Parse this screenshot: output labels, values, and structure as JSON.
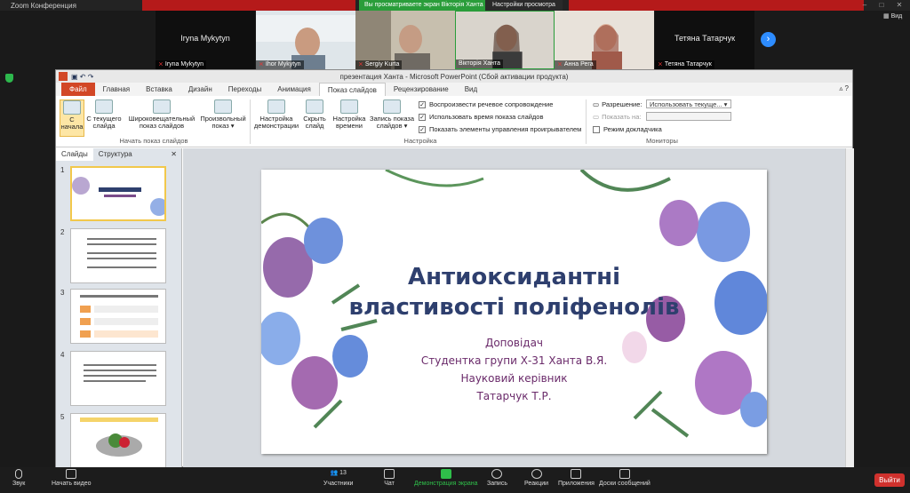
{
  "zoom": {
    "window_title": "Zoom Конференция",
    "share_banner": "Вы просматриваете экран Вікторія Ханта",
    "view_options": "Настройки просмотра",
    "view_btn": "Вид"
  },
  "participants": [
    {
      "label": "Iryna Mykytyn",
      "name": "Iryna Mykytyn",
      "video": false
    },
    {
      "label": "Ihor Mykytyn",
      "video": true
    },
    {
      "label": "Sergiy Kurta",
      "video": true
    },
    {
      "label": "Вікторія Ханта",
      "video": true
    },
    {
      "label": "Анна Рега",
      "video": true
    },
    {
      "label": "Тетяна Татарчук",
      "name": "Тетяна Татарчук",
      "video": false
    }
  ],
  "ppt": {
    "title": "презентация Ханта  -  Microsoft PowerPoint (Сбой активации продукта)",
    "tabs": [
      "Файл",
      "Главная",
      "Вставка",
      "Дизайн",
      "Переходы",
      "Анимация",
      "Показ слайдов",
      "Рецензирование",
      "Вид"
    ],
    "active_tab": "Показ слайдов",
    "ribbon": {
      "from_start": "С\nначала",
      "from_current": "С текущего\nслайда",
      "broadcast": "Широковещательный\nпоказ слайдов",
      "custom": "Произвольный\nпоказ ▾",
      "group1": "Начать показ слайдов",
      "setup": "Настройка\nдемонстрации",
      "hide": "Скрыть\nслайд",
      "rehearse": "Настройка\nвремени",
      "record": "Запись показа\nслайдов ▾",
      "chk1": "Воспроизвести речевое сопровождение",
      "chk2": "Использовать время показа слайдов",
      "chk3": "Показать элементы управления проигрывателем",
      "group2": "Настройка",
      "resolution_label": "Разрешение:",
      "resolution_value": "Использовать текуще...",
      "show_on_label": "Показать на:",
      "presenter": "Режим докладчика",
      "group3": "Мониторы"
    },
    "pane_tabs": [
      "Слайды",
      "Структура"
    ],
    "slide_numbers": [
      "1",
      "2",
      "3",
      "4",
      "5"
    ]
  },
  "slide": {
    "title_line1": "Антиоксидантні",
    "title_line2": "властивості поліфенолів",
    "sub1": "Доповідач",
    "sub2": "Студентка групи Х-31 Ханта В.Я.",
    "sub3": "Науковий керівник",
    "sub4": "Татарчук Т.Р."
  },
  "bottom": {
    "sound": "Звук",
    "video": "Начать видео",
    "participants": "Участники",
    "participants_count": "13",
    "chat": "Чат",
    "share": "Демонстрация экрана",
    "record": "Запись",
    "reactions": "Реакции",
    "apps": "Приложения",
    "whiteboard": "Доски сообщений",
    "leave": "Выйти"
  }
}
